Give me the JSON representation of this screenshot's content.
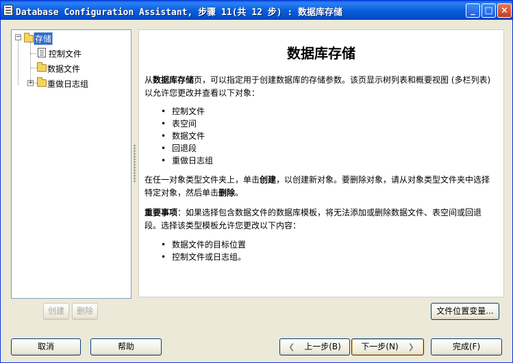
{
  "window": {
    "title": "Database Configuration Assistant, 步骤 11(共 12 步) : 数据库存储",
    "min_glyph": "_",
    "max_glyph": "□",
    "close_glyph": "×"
  },
  "tree": {
    "root_label": "存储",
    "root_expander": "−",
    "items": [
      {
        "label": "控制文件",
        "icon": "document-icon"
      },
      {
        "label": "数据文件",
        "icon": "folder-icon"
      },
      {
        "label": "重做日志组",
        "icon": "folder-icon",
        "expander": "+"
      }
    ]
  },
  "content": {
    "heading": "数据库存储",
    "intro_prefix": "从",
    "intro_bold": "数据库存储",
    "intro_rest": "页，可以指定用于创建数据库的存储参数。该页显示树列表和概要视图 (多栏列表) 以允许您更改并查看以下对象：",
    "objects": [
      "控制文件",
      "表空间",
      "数据文件",
      "回退段",
      "重做日志组"
    ],
    "create_prefix": "在任一对象类型文件夹上，单击",
    "create_bold": "创建",
    "create_middle": "，以创建新对象。要删除对象，请从对象类型文件夹中选择特定对象，然后单击",
    "create_bold2": "删除",
    "create_suffix": "。",
    "important_bold": "重要事项",
    "important_rest": "：如果选择包含数据文件的数据库模板，将无法添加或删除数据文件、表空间或回退段。选择该类型模板允许您更改以下内容：",
    "changes": [
      "数据文件的目标位置",
      "控制文件或日志组。"
    ]
  },
  "buttons": {
    "create": "创建",
    "delete": "删除",
    "file_location_vars": "文件位置变量...",
    "cancel": "取消",
    "help": "帮助",
    "back": "上一步(B)",
    "next": "下一步(N)",
    "finish": "完成(F)",
    "back_arrow": "❮",
    "next_arrow": "❯"
  }
}
